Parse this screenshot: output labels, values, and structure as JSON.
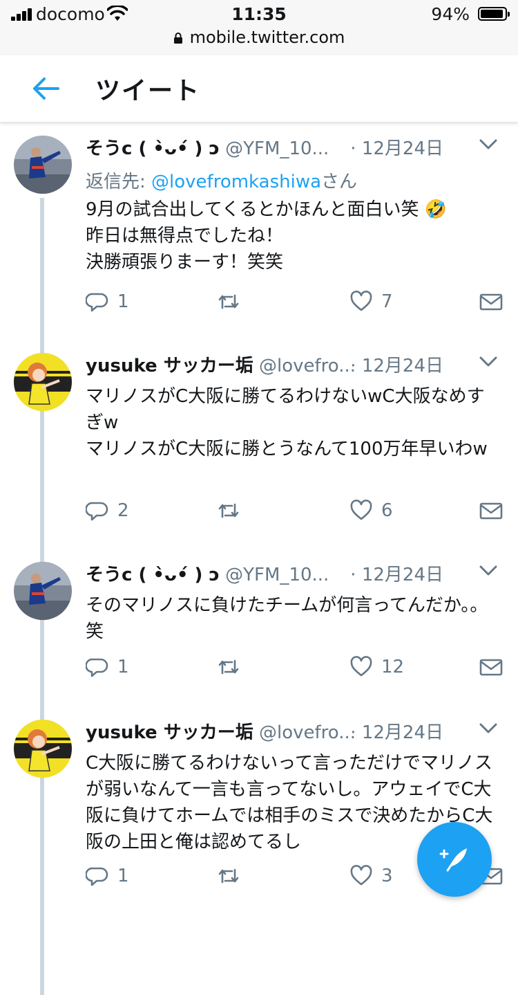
{
  "status_bar": {
    "carrier": "docomo",
    "time": "11:35",
    "battery": "94%",
    "url": "mobile.twitter.com"
  },
  "header": {
    "title": "ツイート"
  },
  "tweets": [
    {
      "name": "そうc ( •̀ᴗ•́ ) ɔ",
      "handle": "@YFM_10...",
      "date": "· 12月24日",
      "reply_prefix": "返信先: ",
      "reply_mention": "@lovefromkashiwa",
      "reply_suffix": "さん",
      "text": "9月の試合出してくるとかほんと面白い笑 🤣\n昨日は無得点でしたね！\n決勝頑張りまーす！笑笑",
      "replies": "1",
      "retweets": "",
      "likes": "7",
      "avatar": "player-avatar"
    },
    {
      "name": "yusuke サッカー垢",
      "handle": "@lovefro...",
      "date": "· 12月24日",
      "text": "マリノスがC大阪に勝てるわけないwC大阪なめすぎw\nマリノスがC大阪に勝とうなんて100万年早いわw",
      "replies": "2",
      "retweets": "",
      "likes": "6",
      "avatar": "anime-avatar"
    },
    {
      "name": "そうc ( •̀ᴗ•́ ) ɔ",
      "handle": "@YFM_10...",
      "date": "· 12月24日",
      "text": "そのマリノスに負けたチームが何言ってんだか。。笑",
      "replies": "1",
      "retweets": "",
      "likes": "12",
      "avatar": "player-avatar"
    },
    {
      "name": "yusuke サッカー垢",
      "handle": "@lovefro...",
      "date": "· 12月24日",
      "text": "C大阪に勝てるわけないって言っただけでマリノスが弱いなんて一言も言ってないし。アウェイでC大阪に負けてホームでは相手のミスで決めたからC大阪の上田と俺は認めてるし",
      "replies": "1",
      "retweets": "",
      "likes": "3",
      "avatar": "anime-avatar"
    }
  ],
  "icons": {
    "back": "arrow-left-icon",
    "reply": "reply-icon",
    "retweet": "retweet-icon",
    "like": "heart-icon",
    "dm": "mail-icon",
    "more": "chevron-down-icon",
    "compose": "compose-feather-icon"
  },
  "colors": {
    "accent": "#1da1f2",
    "muted": "#657786",
    "thread_line": "#ccd6dd"
  }
}
